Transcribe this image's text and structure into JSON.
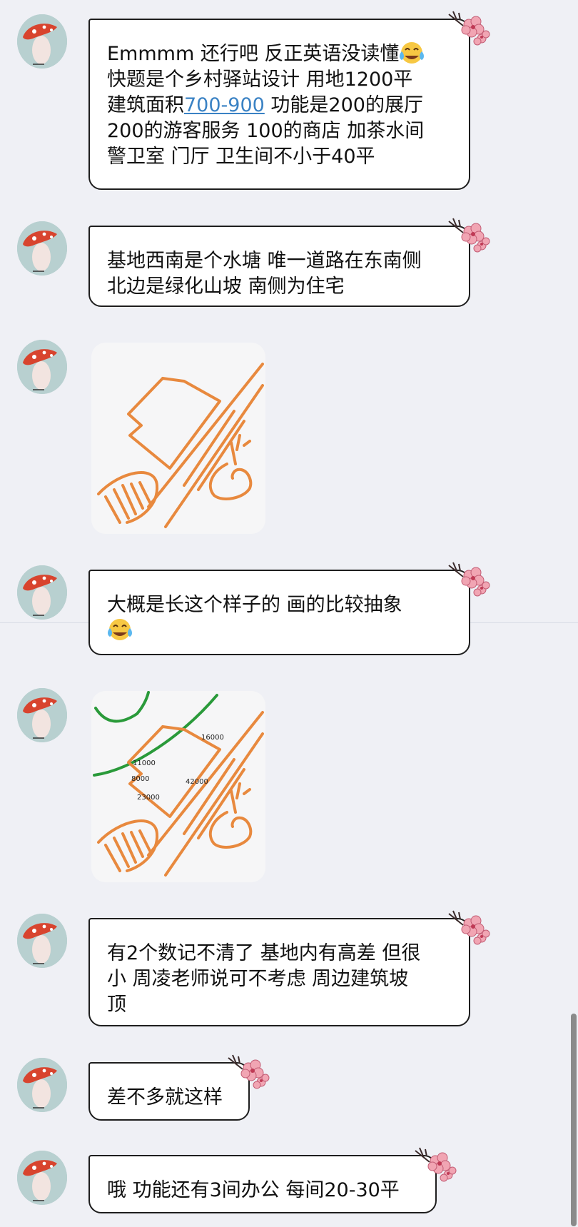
{
  "messages": [
    {
      "type": "text",
      "lines": [
        "Emmmm 还行吧 反正英语没读懂",
        "快题是个乡村驿站设计 用地1200平",
        "建筑面积",
        "功能是200的展厅",
        "200的游客服务 100的商店 加茶水间",
        "警卫室 门厅 卫生间不小于40平"
      ],
      "link": "700-900",
      "emoji": "face-with-tears-of-joy"
    },
    {
      "type": "text",
      "lines": [
        "基地西南是个水塘 唯一道路在东南侧",
        "北边是绿化山坡 南侧为住宅"
      ]
    },
    {
      "type": "image",
      "name": "site-sketch"
    },
    {
      "type": "text",
      "lines": [
        "大概是长这个样子的 画的比较抽象"
      ],
      "emoji": "face-with-tears-of-joy"
    },
    {
      "type": "image",
      "name": "annotated-site-sketch",
      "labels": [
        "16000",
        "11000",
        "8000",
        "42000",
        "23000"
      ]
    },
    {
      "type": "text",
      "lines": [
        "有2个数记不清了 基地内有高差 但很",
        "小 周凌老师说可不考虑 周边建筑坡",
        "顶"
      ]
    },
    {
      "type": "text",
      "lines": [
        "差不多就这样"
      ]
    },
    {
      "type": "text",
      "lines": [
        "哦 功能还有3间办公 每间20-30平"
      ]
    }
  ],
  "colors": {
    "background": "#eff0f5",
    "bubble": "#ffffff",
    "border": "#1e1e1e",
    "link": "#3a82c4",
    "sketch_orange": "#e8893e",
    "sketch_green": "#2a9a3a"
  }
}
